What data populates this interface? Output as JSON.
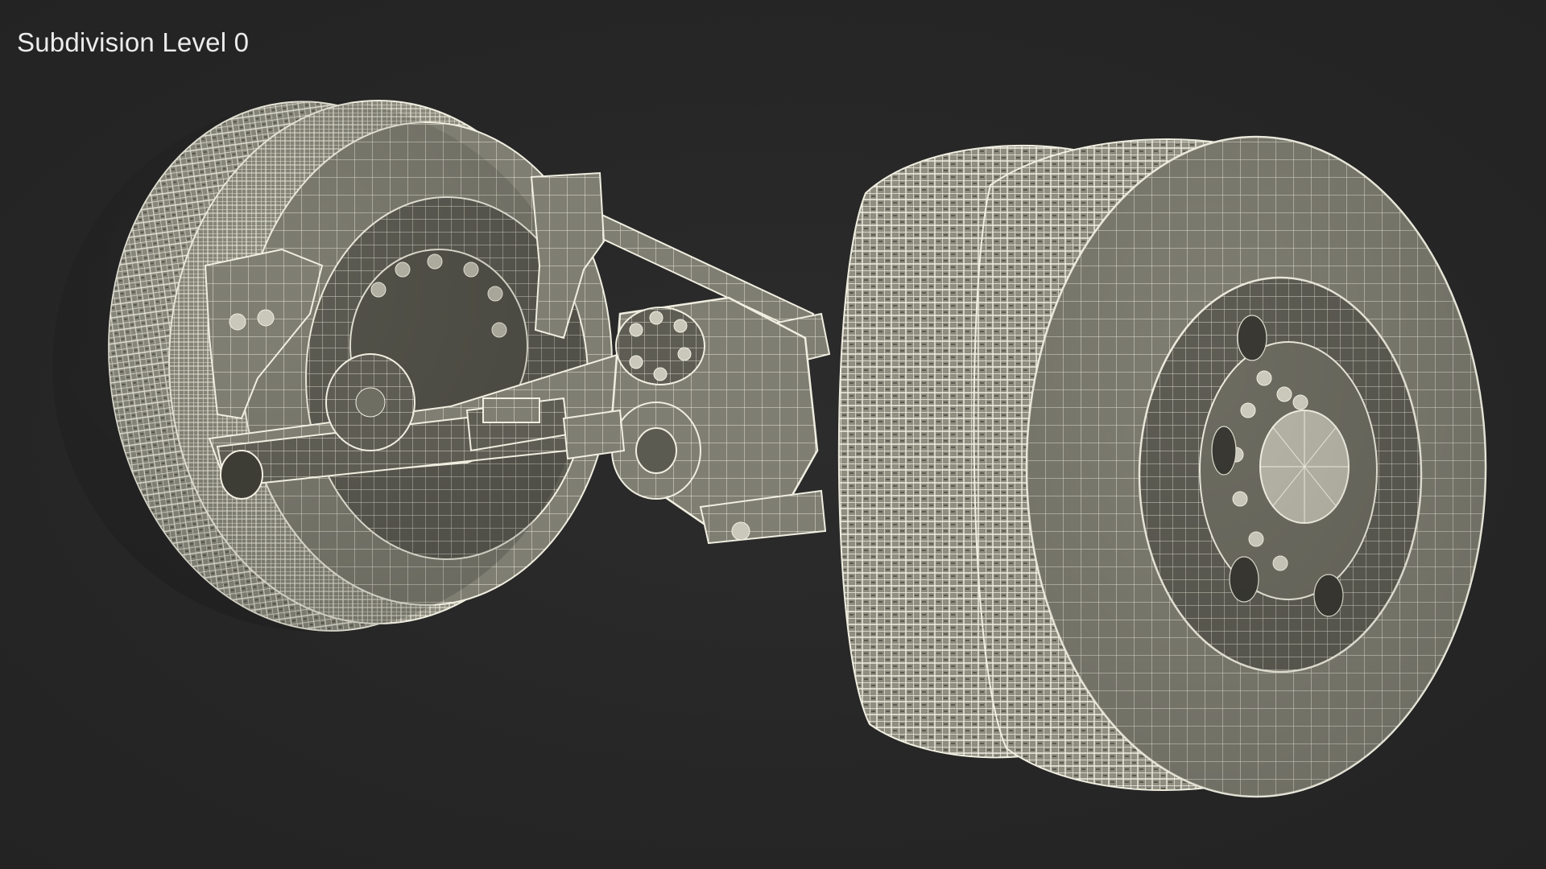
{
  "overlay": {
    "caption": "Subdivision Level 0"
  },
  "render": {
    "subject": "truck-rear-axle-with-dual-wheels-wireframe",
    "background_color": "#262626",
    "mesh_surface_color": "#8b8a7d",
    "wire_color": "#ecebdd"
  }
}
